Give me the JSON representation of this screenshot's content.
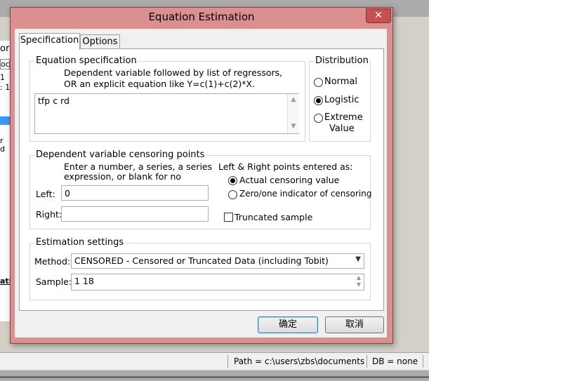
{
  "background": {
    "left_strip": [
      "ork",
      "oc",
      "1",
      ": 1",
      "r",
      "d",
      "atil"
    ],
    "status_bar": {
      "path": "Path = c:\\users\\zbs\\documents",
      "db": "DB = none"
    }
  },
  "dialog": {
    "title": "Equation Estimation",
    "close_glyph": "✕",
    "tabs": [
      {
        "label": "Specification",
        "active": true
      },
      {
        "label": "Options",
        "active": false
      }
    ],
    "equation_spec": {
      "group_label": "Equation specification",
      "hint_line1": "Dependent variable followed by list of regressors,",
      "hint_line2": "OR an explicit equation like Y=c(1)+c(2)*X.",
      "value": "tfp c rd"
    },
    "distribution": {
      "group_label": "Distribution",
      "options": [
        {
          "label": "Normal",
          "selected": false
        },
        {
          "label": "Logistic",
          "selected": true
        },
        {
          "label": "Extreme",
          "label2": "Value",
          "selected": false
        }
      ]
    },
    "censoring": {
      "group_label": "Dependent variable censoring points",
      "hint_line1": "Enter a number, a series, a series",
      "hint_line2": "expression, or blank for no",
      "left_label": "Left:",
      "left_value": "0",
      "right_label": "Right:",
      "right_value": "",
      "entered_as_label": "Left & Right points entered as:",
      "entered_as_options": [
        {
          "label": "Actual censoring value",
          "selected": true
        },
        {
          "label": "Zero/one indicator of censoring",
          "selected": false
        }
      ],
      "truncated_label": "Truncated sample",
      "truncated_checked": false
    },
    "estimation": {
      "group_label": "Estimation settings",
      "method_label": "Method:",
      "method_value": "CENSORED  -  Censored or Truncated Data (including Tobit)",
      "sample_label": "Sample:",
      "sample_value": "1 18"
    },
    "buttons": {
      "ok": "确定",
      "cancel": "取消"
    }
  }
}
